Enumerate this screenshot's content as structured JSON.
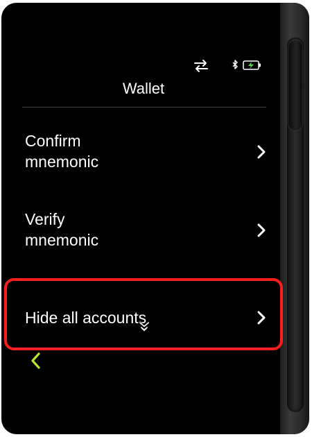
{
  "status_bar": {
    "icons": [
      "transfer-arrows-icon",
      "bluetooth-icon",
      "battery-charging-icon"
    ],
    "battery_color": "#5be04c"
  },
  "header": {
    "title": "Wallet"
  },
  "menu": {
    "items": [
      {
        "label": "Confirm mnemonic",
        "icon": "chevron-right-icon"
      },
      {
        "label": "Verify mnemonic",
        "icon": "chevron-right-icon"
      },
      {
        "label": "Hide all accounts",
        "icon": "chevron-right-icon",
        "highlighted": true
      }
    ]
  },
  "footer": {
    "back_icon": "chevron-left-icon",
    "back_color": "#b7e63c"
  },
  "colors": {
    "background": "#000000",
    "text": "#ffffff",
    "highlight_border": "#ff1e1e",
    "divider": "#3e3e3e"
  }
}
